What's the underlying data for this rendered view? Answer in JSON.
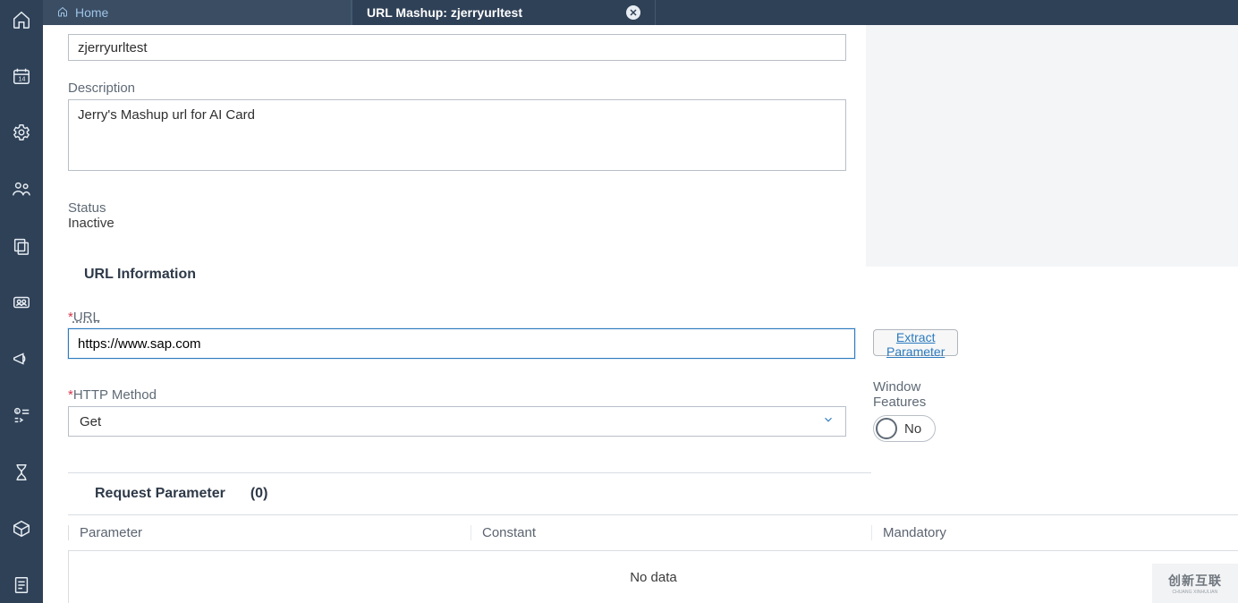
{
  "tabs": {
    "home": "Home",
    "active": "URL Mashup: zjerryurltest"
  },
  "form": {
    "name_value": "zjerryurltest",
    "description_label": "Description",
    "description_value": "Jerry's Mashup url for AI Card",
    "status_label": "Status",
    "status_value": "Inactive"
  },
  "url_section": {
    "title": "URL Information",
    "url_label": "URL",
    "url_value": "https://www.sap.com",
    "extract_label": "Extract Parameter",
    "http_label": "HTTP Method",
    "http_value": "Get",
    "window_features_label": "Window Features",
    "window_features_value": "No"
  },
  "params": {
    "title": "Request Parameter",
    "count": "(0)",
    "col_parameter": "Parameter",
    "col_constant": "Constant",
    "col_mandatory": "Mandatory",
    "empty": "No data"
  },
  "watermark": {
    "text1": "创新互联",
    "text2": "CHUANG XINHULIAN"
  }
}
